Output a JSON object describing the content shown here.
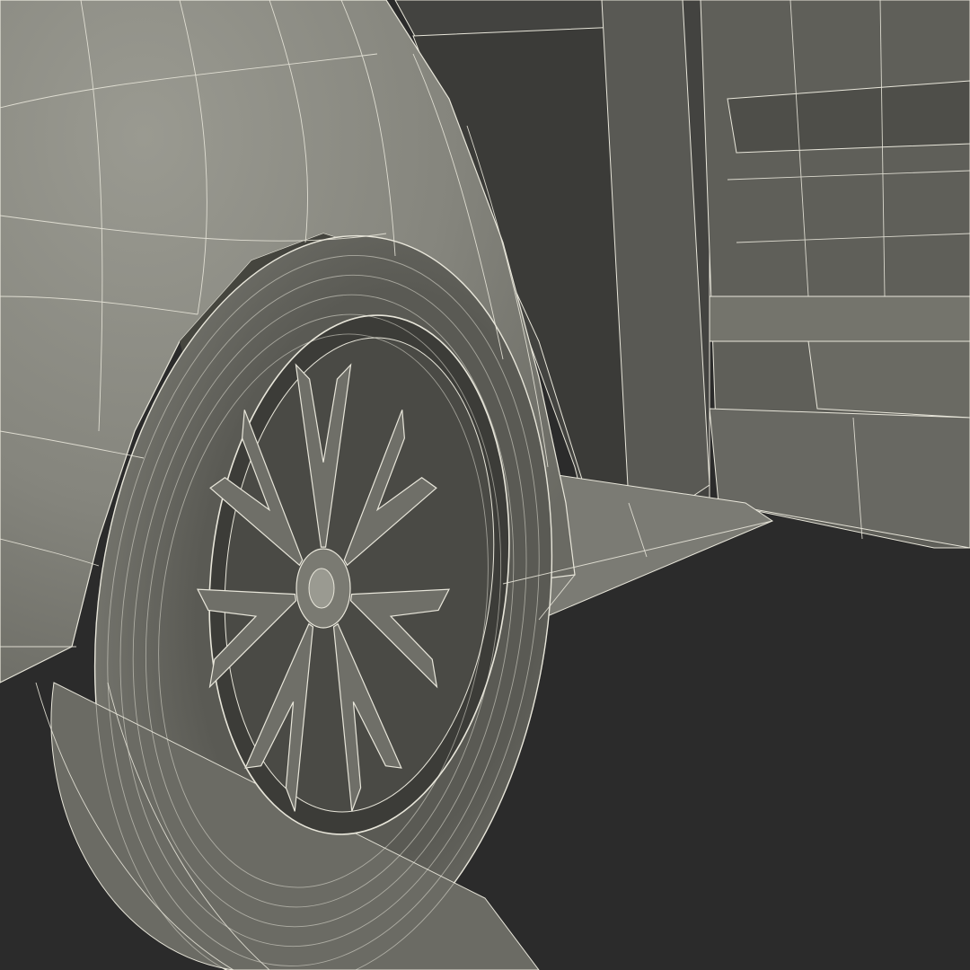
{
  "scene": {
    "subject": "wireframe-render-car-front-wheel-open-door",
    "colors": {
      "background": "#2b2b2b",
      "body_light": "#8f8f86",
      "body_mid": "#7a7a72",
      "body_dark": "#4a4a45",
      "interior": "#3e3e3a",
      "tire": "#6e6e67",
      "rim": "#6f6f68",
      "rim_shadow": "#3a3a36",
      "wire": "#e8e6da"
    },
    "wheel": {
      "spoke_pairs": 7
    }
  }
}
